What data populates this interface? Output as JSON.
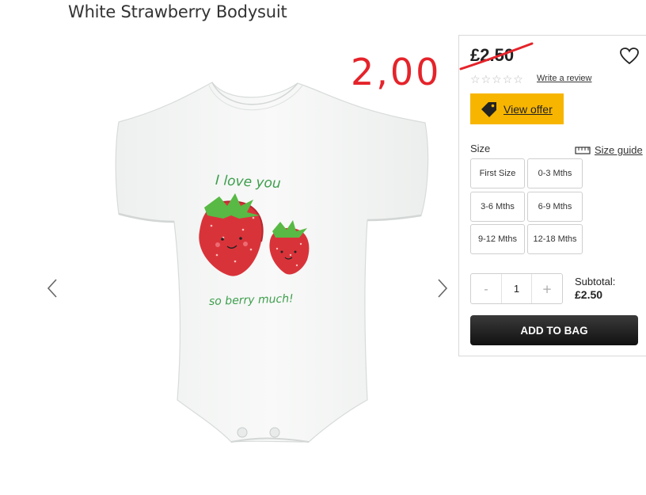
{
  "product": {
    "title": "White Strawberry Bodysuit",
    "print_line1": "I love you",
    "print_line2": "so berry much!"
  },
  "annotation": {
    "handwritten_price": "2,00",
    "color": "#e5232a"
  },
  "pricing": {
    "old_price": "£2.50"
  },
  "reviews": {
    "stars_filled": 0,
    "stars_total": 5,
    "link_label": "Write a review"
  },
  "offer": {
    "label": "View offer",
    "color": "#f7b500",
    "icon": "price-tag-icon"
  },
  "size": {
    "label": "Size",
    "guide_label": "Size guide",
    "guide_icon": "ruler-icon",
    "options": [
      "First Size",
      "0-3 Mths",
      "3-6 Mths",
      "6-9 Mths",
      "9-12 Mths",
      "12-18 Mths"
    ]
  },
  "quantity": {
    "minus_label": "-",
    "value": "1",
    "plus_label": "+"
  },
  "subtotal": {
    "label": "Subtotal:",
    "value": "£2.50"
  },
  "cart": {
    "add_label": "ADD TO BAG"
  },
  "gallery": {
    "prev_icon": "chevron-left-icon",
    "next_icon": "chevron-right-icon"
  }
}
